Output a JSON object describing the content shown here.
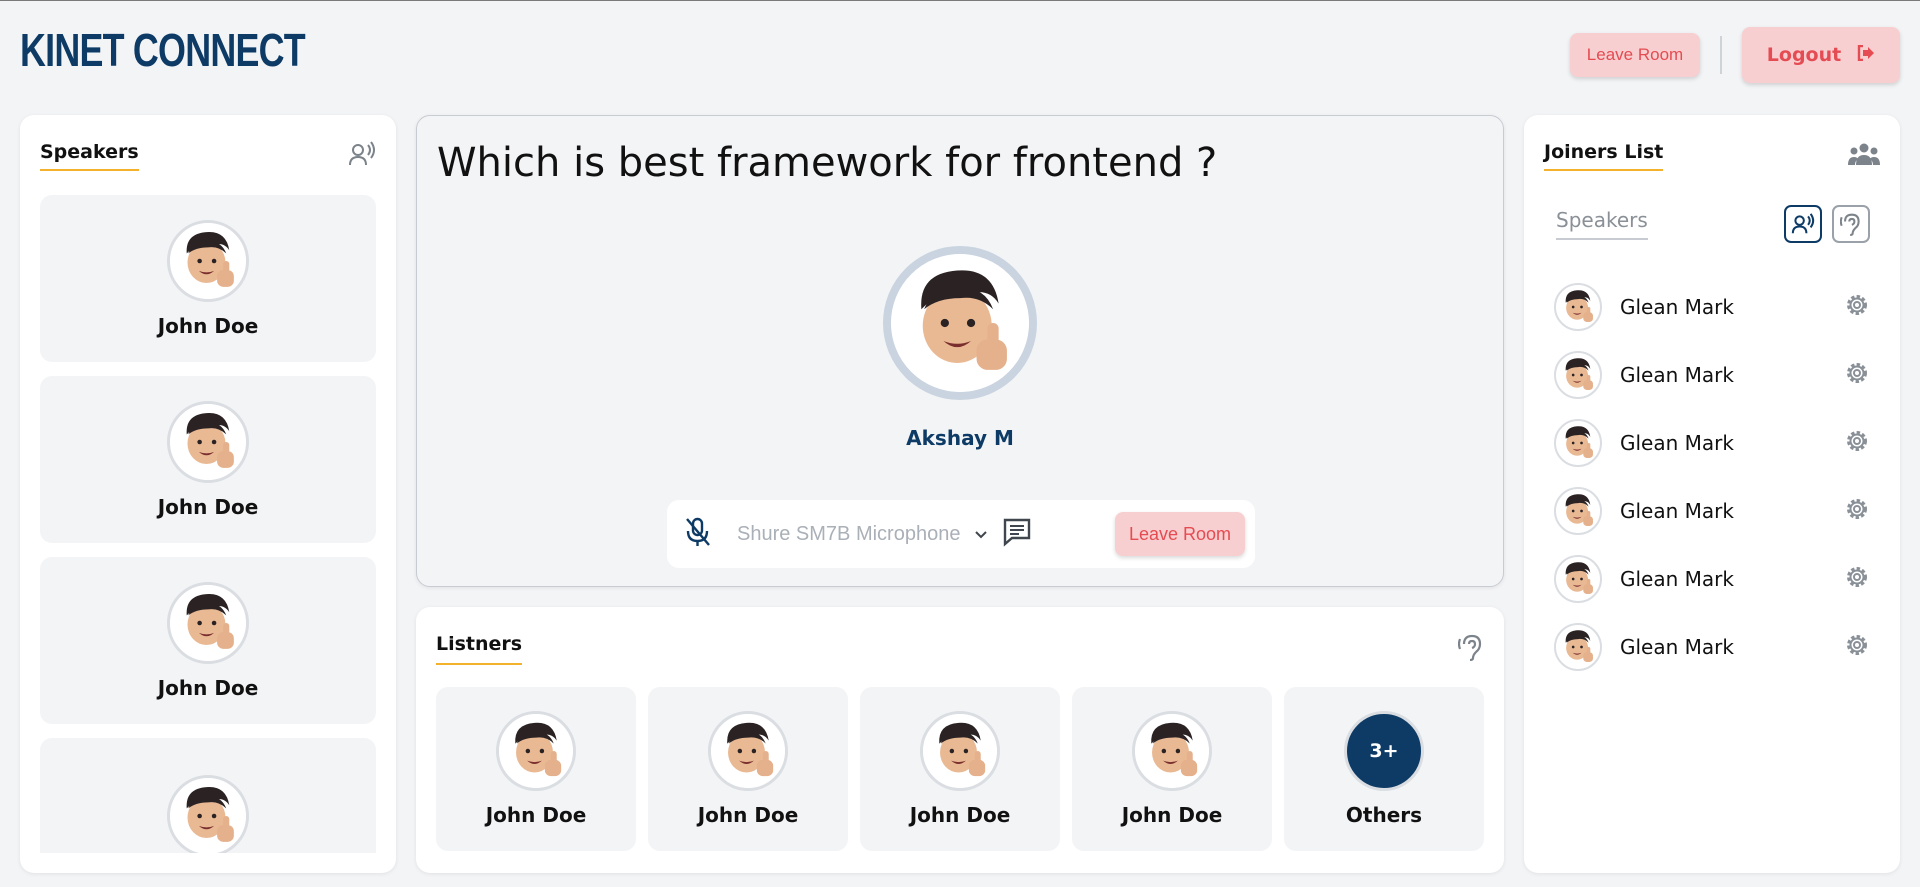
{
  "header": {
    "logo": "KINET CONNECT",
    "leave_room": "Leave Room",
    "logout": "Logout"
  },
  "speakers": {
    "title": "Speakers",
    "items": [
      {
        "name": "John Doe"
      },
      {
        "name": "John Doe"
      },
      {
        "name": "John Doe"
      },
      {
        "name": ""
      }
    ]
  },
  "room": {
    "question": "Which is best framework for frontend ?",
    "host_name": "Akshay M",
    "microphone": "Shure SM7B Microphone",
    "leave_room": "Leave Room"
  },
  "listeners": {
    "title": "Listners",
    "items": [
      {
        "name": "John Doe"
      },
      {
        "name": "John Doe"
      },
      {
        "name": "John Doe"
      },
      {
        "name": "John Doe"
      }
    ],
    "others_count": "3+",
    "others_label": "Others"
  },
  "joiners": {
    "title": "Joiners List",
    "filter_label": "Speakers",
    "items": [
      {
        "name": "Glean Mark"
      },
      {
        "name": "Glean Mark"
      },
      {
        "name": "Glean Mark"
      },
      {
        "name": "Glean Mark"
      },
      {
        "name": "Glean Mark"
      },
      {
        "name": "Glean Mark"
      }
    ]
  },
  "colors": {
    "brand": "#0d3b66",
    "accent": "#f3b12c",
    "danger": "#e44b52",
    "danger_bg": "#f8cfd0"
  }
}
